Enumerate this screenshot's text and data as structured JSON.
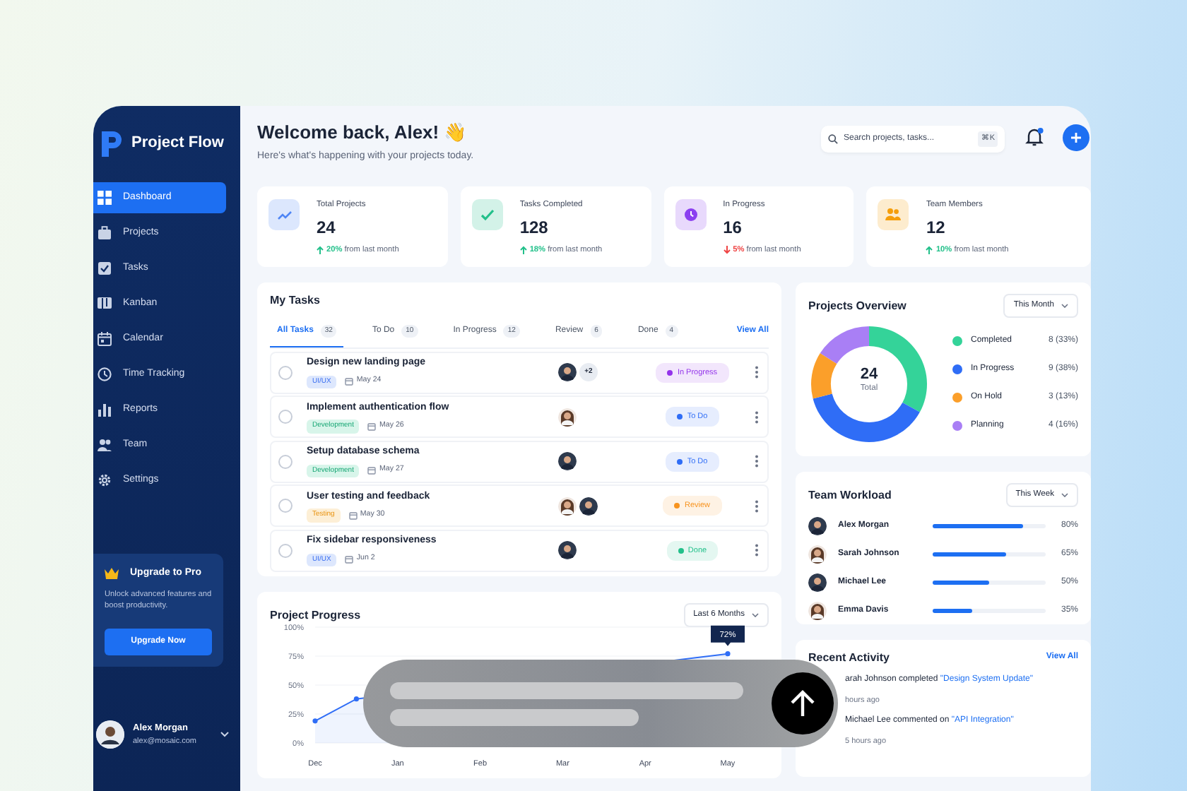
{
  "sidebar": {
    "brand": "Project Flow",
    "items": [
      {
        "label": "Dashboard",
        "selected": true
      },
      {
        "label": "Projects",
        "selected": false
      },
      {
        "label": "Tasks",
        "selected": false
      },
      {
        "label": "Kanban",
        "selected": false
      },
      {
        "label": "Calendar",
        "selected": false
      },
      {
        "label": "Time Tracking",
        "selected": false
      },
      {
        "label": "Reports",
        "selected": false
      },
      {
        "label": "Team",
        "selected": false
      },
      {
        "label": "Settings",
        "selected": false
      }
    ],
    "upgrade": {
      "title": "Upgrade to Pro",
      "text": "Unlock advanced features and boost productivity.",
      "button": "Upgrade Now"
    },
    "user": {
      "name": "Alex Morgan",
      "email": "alex@mosaic.com"
    }
  },
  "header": {
    "title": "Welcome back, Alex! 👋",
    "subtitle": "Here's what's happening with your projects today.",
    "search": {
      "placeholder": "Search projects, tasks...",
      "shortcut": "⌘K"
    },
    "notifications": {
      "unread": true
    }
  },
  "stats": [
    {
      "label": "Total Projects",
      "value": "24",
      "increase": true,
      "change": "20%",
      "note": "from last month",
      "color": "#4f86f5"
    },
    {
      "label": "Tasks Completed",
      "value": "128",
      "increase": true,
      "change": "18%",
      "note": "from last month",
      "color": "#22c08a"
    },
    {
      "label": "In Progress",
      "value": "16",
      "increase": false,
      "change": "5%",
      "note": "from last month",
      "color": "#8b3ff0"
    },
    {
      "label": "Team Members",
      "value": "12",
      "increase": true,
      "change": "10%",
      "note": "from last month",
      "color": "#f59e0b"
    }
  ],
  "my_tasks": {
    "title": "My Tasks",
    "view_all": "View All",
    "tabs": [
      {
        "label": "All Tasks",
        "count": "32",
        "selected": true
      },
      {
        "label": "To Do",
        "count": "10",
        "selected": false
      },
      {
        "label": "In Progress",
        "count": "12",
        "selected": false
      },
      {
        "label": "Review",
        "count": "6",
        "selected": false
      },
      {
        "label": "Done",
        "count": "4",
        "selected": false
      }
    ],
    "tasks": [
      {
        "title": "Design new landing page",
        "checked": false,
        "tag": {
          "label": "UI/UX",
          "kind": "design"
        },
        "date": "May 24",
        "assignees": [
          {
            "kind": "male"
          }
        ],
        "extra": "+2",
        "status": {
          "label": "In Progress",
          "color": "#9333ea"
        }
      },
      {
        "title": "Implement authentication flow",
        "checked": false,
        "tag": {
          "label": "Development",
          "kind": "development"
        },
        "date": "May 26",
        "assignees": [
          {
            "kind": "female"
          }
        ],
        "status": {
          "label": "To Do",
          "color": "#2f6df6"
        }
      },
      {
        "title": "Setup database schema",
        "checked": false,
        "tag": {
          "label": "Development",
          "kind": "development"
        },
        "date": "May 27",
        "assignees": [
          {
            "kind": "male"
          }
        ],
        "status": {
          "label": "To Do",
          "color": "#2f6df6"
        }
      },
      {
        "title": "User testing and feedback",
        "checked": false,
        "tag": {
          "label": "Testing",
          "kind": "testing"
        },
        "date": "May 30",
        "assignees": [
          {
            "kind": "female"
          },
          {
            "kind": "male"
          }
        ],
        "status": {
          "label": "Review",
          "color": "#f7931e"
        }
      },
      {
        "title": "Fix sidebar responsiveness",
        "checked": false,
        "tag": {
          "label": "UI/UX",
          "kind": "design"
        },
        "date": "Jun 2",
        "assignees": [
          {
            "kind": "male"
          }
        ],
        "status": {
          "label": "Done",
          "color": "#22c08a"
        }
      }
    ]
  },
  "project_progress": {
    "title": "Project Progress",
    "range": "Last 6 Months",
    "chart_data": {
      "type": "area",
      "grid": true,
      "marker": true,
      "categories": [
        "Dec",
        null,
        "Jan",
        null,
        "Feb",
        null,
        "Mar",
        null,
        "Apr",
        null,
        "May"
      ],
      "yticks": [
        {
          "value": 0,
          "label": "0%"
        },
        {
          "value": 25,
          "label": "25%"
        },
        {
          "value": 50,
          "label": "50%"
        },
        {
          "value": 75,
          "label": "75%"
        },
        {
          "value": 100,
          "label": "100%"
        }
      ],
      "ylim": [
        0,
        100
      ],
      "series": [
        {
          "color": "#2f6df6",
          "values": [
            19,
            38,
            null,
            null,
            null,
            null,
            null,
            null,
            null,
            null,
            77
          ]
        }
      ],
      "annotations": [
        {
          "x": "May",
          "y": 77,
          "text": "72%"
        }
      ]
    }
  },
  "projects_overview": {
    "title": "Projects Overview",
    "range": "This Month",
    "total": "24",
    "total_label": "Total",
    "legend": [
      {
        "label": "Completed",
        "value": "8 (33%)",
        "color": "#34d399"
      },
      {
        "label": "In Progress",
        "value": "9 (38%)",
        "color": "#2f6df6"
      },
      {
        "label": "On Hold",
        "value": "3 (13%)",
        "color": "#fb9f2a"
      },
      {
        "label": "Planning",
        "value": "4 (16%)",
        "color": "#a97ff5"
      }
    ],
    "chart_data": {
      "type": "donut",
      "values": [
        33,
        38,
        13,
        16
      ]
    }
  },
  "team_workload": {
    "title": "Team Workload",
    "range": "This Week",
    "members": [
      {
        "name": "Alex Morgan",
        "kind": "male",
        "level": 0.8,
        "reading": "80%"
      },
      {
        "name": "Sarah Johnson",
        "kind": "female",
        "level": 0.65,
        "reading": "65%"
      },
      {
        "name": "Michael Lee",
        "kind": "male",
        "level": 0.5,
        "reading": "50%"
      },
      {
        "name": "Emma Davis",
        "kind": "female",
        "level": 0.35,
        "reading": "35%"
      }
    ]
  },
  "recent_activity": {
    "title": "Recent Activity",
    "view_all": "View All",
    "items": [
      {
        "text": "arah Johnson completed",
        "link": "\"Design System Update\"",
        "time": "hours ago"
      },
      {
        "text": "Michael Lee commented on",
        "link": "\"API Integration\"",
        "time": "5 hours ago"
      }
    ]
  }
}
